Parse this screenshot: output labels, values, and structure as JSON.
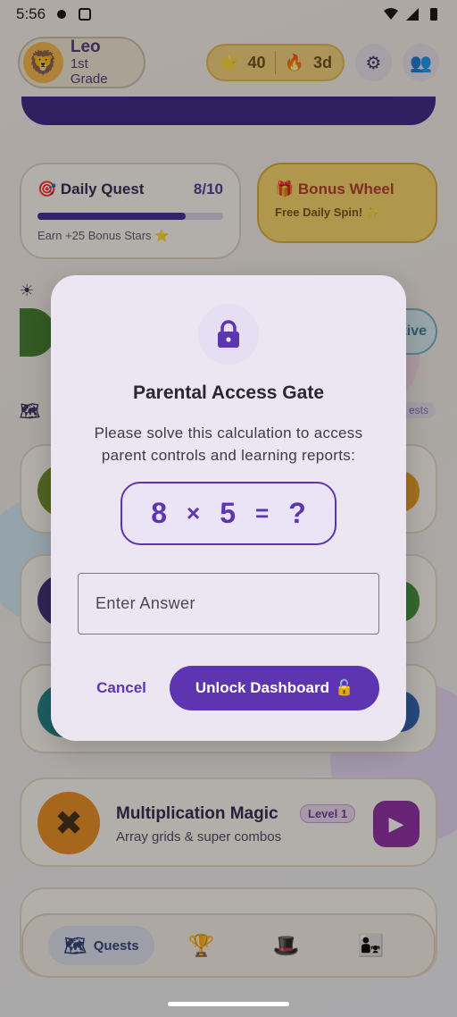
{
  "status_bar": {
    "time": "5:56"
  },
  "profile": {
    "name": "Leo",
    "grade": "1st Grade",
    "avatar_icon": "lion-icon"
  },
  "stats": {
    "stars": "40",
    "streak": "3d"
  },
  "daily_quest": {
    "title": "Daily Quest",
    "progress": "8/10",
    "progress_fraction": 0.8,
    "reward": "Earn +25 Bonus Stars ⭐"
  },
  "bonus_wheel": {
    "title": "Bonus Wheel",
    "subtitle": "Free Daily Spin! ✨"
  },
  "partial_labels": {
    "active_pill": "tive",
    "quests_tag": "ests"
  },
  "multiplication_card": {
    "title": "Multiplication Magic",
    "level": "Level 1",
    "subtitle": "Array grids & super combos"
  },
  "bottom_nav": {
    "quests_label": "Quests"
  },
  "dialog": {
    "title": "Parental Access Gate",
    "body": "Please solve this calculation to access parent controls and learning reports:",
    "equation": {
      "a": "8",
      "op": "×",
      "b": "5",
      "eq": "=",
      "unknown": "?"
    },
    "answer_placeholder": "Enter Answer",
    "cancel_label": "Cancel",
    "unlock_label": "Unlock Dashboard",
    "unlock_emoji": "🔓"
  },
  "colors": {
    "primary": "#5e35b1",
    "dialog_bg": "#ece6f3"
  }
}
